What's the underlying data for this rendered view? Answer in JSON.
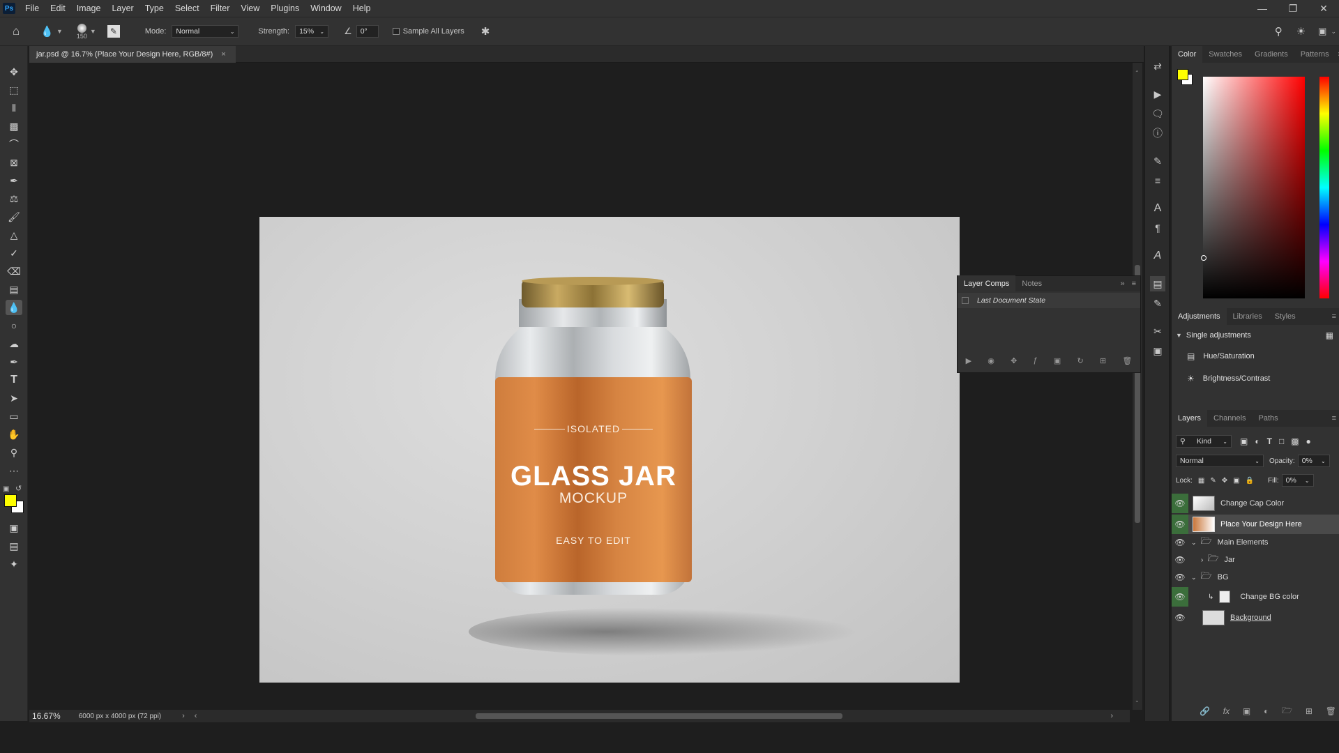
{
  "menu": {
    "app_icon": "Ps",
    "items": [
      "File",
      "Edit",
      "Image",
      "Layer",
      "Type",
      "Select",
      "Filter",
      "View",
      "Plugins",
      "Window",
      "Help"
    ]
  },
  "options": {
    "brush_size": "150",
    "mode_label": "Mode:",
    "mode_value": "Normal",
    "strength_label": "Strength:",
    "strength_value": "15%",
    "angle_value": "0°",
    "sample_all_layers": "Sample All Layers"
  },
  "document": {
    "tab_title": "jar.psd @ 16.7% (Place Your Design Here, RGB/8#)",
    "zoom": "16.67%",
    "dimensions": "6000 px x 4000 px (72 ppi)"
  },
  "artwork": {
    "line1": "ISOLATED",
    "title": "GLASS JAR",
    "subtitle": "MOCKUP",
    "tagline": "EASY TO EDIT"
  },
  "layer_comps": {
    "tabs": [
      "Layer Comps",
      "Notes"
    ],
    "state": "Last Document State"
  },
  "color_panel": {
    "tabs": [
      "Color",
      "Swatches",
      "Gradients",
      "Patterns"
    ],
    "foreground": "#ffff00",
    "background": "#ffffff"
  },
  "adjustments_panel": {
    "tabs": [
      "Adjustments",
      "Libraries",
      "Styles"
    ],
    "section": "Single adjustments",
    "items": [
      "Hue/Saturation",
      "Brightness/Contrast"
    ]
  },
  "layers_panel": {
    "tabs": [
      "Layers",
      "Channels",
      "Paths"
    ],
    "filter": "Kind",
    "blend_mode": "Normal",
    "opacity_label": "Opacity:",
    "opacity": "0%",
    "lock_label": "Lock:",
    "fill_label": "Fill:",
    "fill": "0%",
    "layers": [
      {
        "name": "Change Cap Color",
        "type": "smart"
      },
      {
        "name": "Place Your Design Here",
        "type": "smart",
        "selected": true
      },
      {
        "name": "Main Elements",
        "type": "group",
        "open": true
      },
      {
        "name": "Jar",
        "type": "group",
        "open": false
      },
      {
        "name": "BG",
        "type": "group",
        "open": true
      },
      {
        "name": "Change BG color",
        "type": "fill"
      },
      {
        "name": "Background",
        "type": "background"
      }
    ]
  }
}
